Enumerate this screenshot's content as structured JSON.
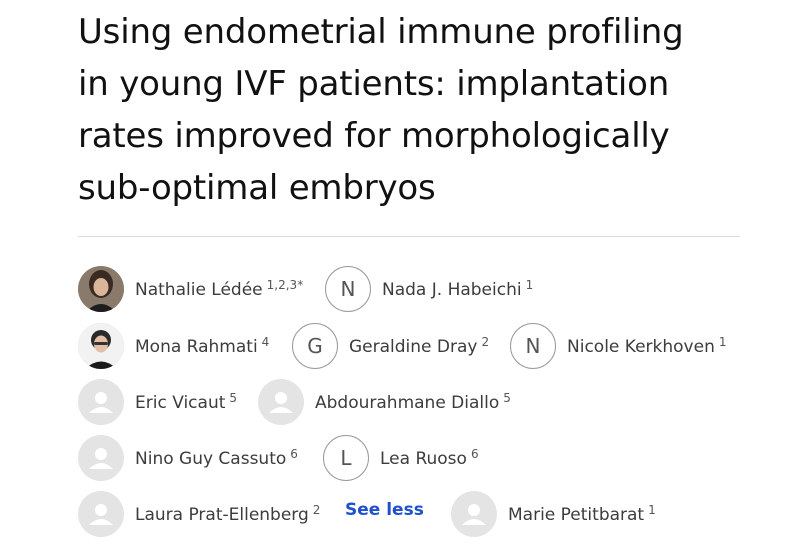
{
  "article": {
    "title_lines": [
      "Using endometrial immune profiling",
      "in young IVF patients: implantation",
      "rates improved for morphologically",
      "sub-optimal embryos"
    ]
  },
  "authors": [
    {
      "name": "Nathalie Lédée",
      "aff": "1,2,3*",
      "avatar": "photo"
    },
    {
      "name": "Nada J. Habeichi",
      "aff": "1",
      "avatar": "letter",
      "initial": "N"
    },
    {
      "name": "Mona Rahmati",
      "aff": "4",
      "avatar": "photo"
    },
    {
      "name": "Geraldine Dray",
      "aff": "2",
      "avatar": "letter",
      "initial": "G"
    },
    {
      "name": "Nicole Kerkhoven",
      "aff": "1",
      "avatar": "letter",
      "initial": "N"
    },
    {
      "name": "Eric Vicaut",
      "aff": "5",
      "avatar": "placeholder"
    },
    {
      "name": "Abdourahmane Diallo",
      "aff": "5",
      "avatar": "placeholder"
    },
    {
      "name": "Nino Guy Cassuto",
      "aff": "6",
      "avatar": "placeholder"
    },
    {
      "name": "Lea Ruoso",
      "aff": "6",
      "avatar": "letter",
      "initial": "L"
    },
    {
      "name": "Laura Prat-Ellenberg",
      "aff": "2",
      "avatar": "placeholder"
    },
    {
      "name": "Marie Petitbarat",
      "aff": "1",
      "avatar": "placeholder"
    }
  ],
  "see_less_label": "See less",
  "colors": {
    "link": "#1d4fcf",
    "avatar_placeholder": "#e4e4e4"
  }
}
